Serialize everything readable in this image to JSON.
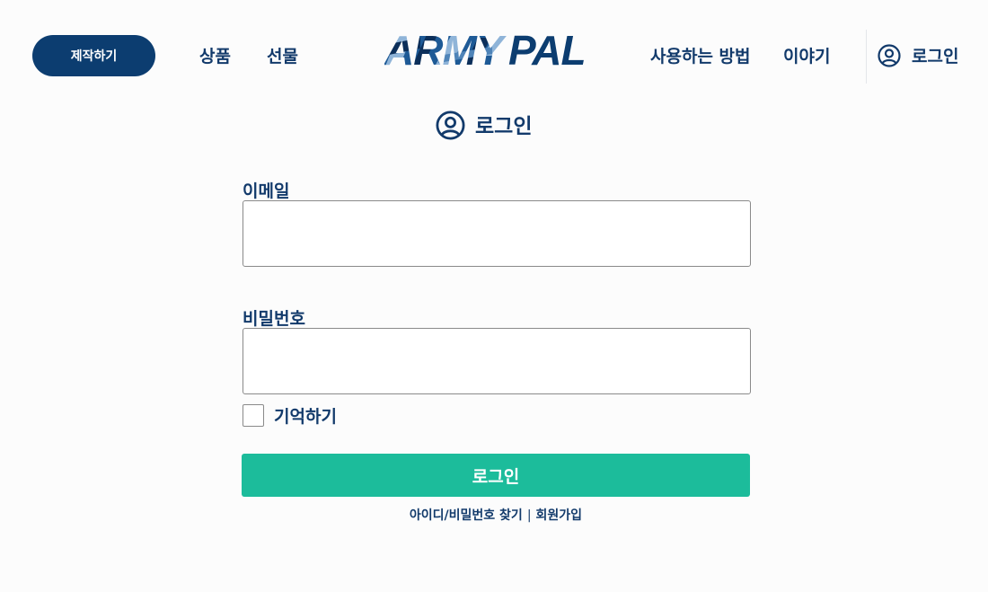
{
  "header": {
    "make_button": "제작하기",
    "nav_left": [
      "상품",
      "선물"
    ],
    "logo_text": "ARMYPAL",
    "nav_right": [
      "사용하는 방법",
      "이야기"
    ],
    "login_label": "로그인"
  },
  "login_form": {
    "title": "로그인",
    "email_label": "이메일",
    "email_value": "",
    "password_label": "비밀번호",
    "password_value": "",
    "remember_label": "기억하기",
    "remember_checked": false,
    "submit_label": "로그인",
    "find_link": "아이디/비밀번호 찾기",
    "separator": "|",
    "signup_link": "회원가입"
  },
  "colors": {
    "navy": "#0c3d70",
    "text": "#123a6b",
    "accent": "#1cbc9b",
    "logo_light": "#8fb4d8"
  },
  "icons": {
    "user": "user-circle-icon"
  }
}
